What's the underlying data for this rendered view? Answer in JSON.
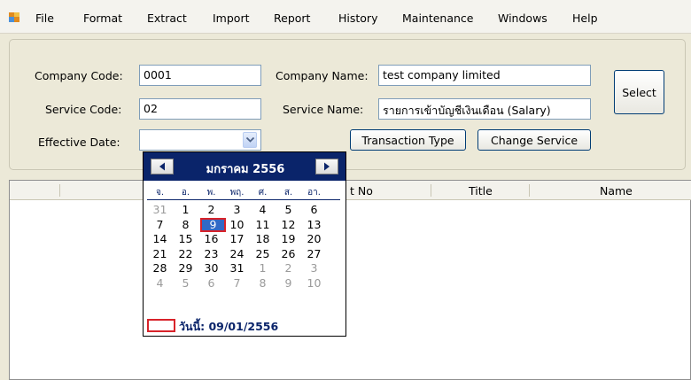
{
  "menu": {
    "items": [
      "File",
      "Format",
      "Extract",
      "Import",
      "Report",
      "History",
      "Maintenance",
      "Windows",
      "Help"
    ]
  },
  "form": {
    "company_code_label": "Company Code:",
    "company_code_value": "0001",
    "service_code_label": "Service Code:",
    "service_code_value": "02",
    "effective_date_label": "Effective Date:",
    "effective_date_value": "",
    "company_name_label": "Company Name:",
    "company_name_value": "test company limited",
    "service_name_label": "Service Name:",
    "service_name_value": "รายการเข้าบัญชีเงินเดือน (Salary)",
    "select_button": "Select",
    "transaction_type_button": "Transaction Type",
    "change_service_button": "Change Service"
  },
  "grid": {
    "columns": [
      "t No",
      "Title",
      "Name"
    ]
  },
  "calendar": {
    "month_title": "มกราคม 2556",
    "weekdays": [
      "จ.",
      "อ.",
      "พ.",
      "พฤ.",
      "ศ.",
      "ส.",
      "อา."
    ],
    "weeks": [
      [
        "31",
        "1",
        "2",
        "3",
        "4",
        "5",
        "6"
      ],
      [
        "7",
        "8",
        "9",
        "10",
        "11",
        "12",
        "13"
      ],
      [
        "14",
        "15",
        "16",
        "17",
        "18",
        "19",
        "20"
      ],
      [
        "21",
        "22",
        "23",
        "24",
        "25",
        "26",
        "27"
      ],
      [
        "28",
        "29",
        "30",
        "31",
        "1",
        "2",
        "3"
      ],
      [
        "4",
        "5",
        "6",
        "7",
        "8",
        "9",
        "10"
      ]
    ],
    "selected_day": "9",
    "today_label": "วันนี้: 09/01/2556",
    "colors": {
      "header": "#0a246a",
      "selected": "#3169c6",
      "today_marker": "#d8232a",
      "other_month": "#9a9a9a"
    }
  }
}
